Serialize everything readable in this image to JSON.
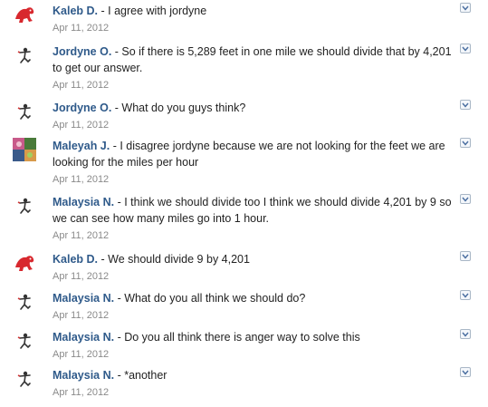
{
  "comments": [
    {
      "author": "Kaleb D.",
      "text": " - I agree with jordyne",
      "date": "Apr 11, 2012",
      "avatar": "red-dinosaur-icon"
    },
    {
      "author": "Jordyne O.",
      "text": " - So if there is 5,289 feet in one mile we should divide that by 4,201 to get our answer.",
      "date": "Apr 11, 2012",
      "avatar": "stick-figure-icon"
    },
    {
      "author": "Jordyne O.",
      "text": " - What do you guys think?",
      "date": "Apr 11, 2012",
      "avatar": "stick-figure-icon"
    },
    {
      "author": "Maleyah J.",
      "text": " - I disagree jordyne because we are not looking for the feet we are looking for the miles per hour",
      "date": "Apr 11, 2012",
      "avatar": "photo-collage-icon"
    },
    {
      "author": "Malaysia N.",
      "text": " - I think we should divide too I think we should divide 4,201 by 9 so we can see how many miles go into 1 hour.",
      "date": "Apr 11, 2012",
      "avatar": "stick-figure-icon"
    },
    {
      "author": "Kaleb D.",
      "text": " - We should divide 9 by 4,201",
      "date": "Apr 11, 2012",
      "avatar": "red-dinosaur-icon"
    },
    {
      "author": "Malaysia N.",
      "text": " - What do you all think we should do?",
      "date": "Apr 11, 2012",
      "avatar": "stick-figure-icon"
    },
    {
      "author": "Malaysia N.",
      "text": " - Do you all think there is anger way to solve this",
      "date": "Apr 11, 2012",
      "avatar": "stick-figure-icon"
    },
    {
      "author": "Malaysia N.",
      "text": " - *another",
      "date": "Apr 11, 2012",
      "avatar": "stick-figure-icon"
    }
  ],
  "colors": {
    "author": "#2f5a8a",
    "date": "#8a8a8a",
    "text": "#222222"
  }
}
